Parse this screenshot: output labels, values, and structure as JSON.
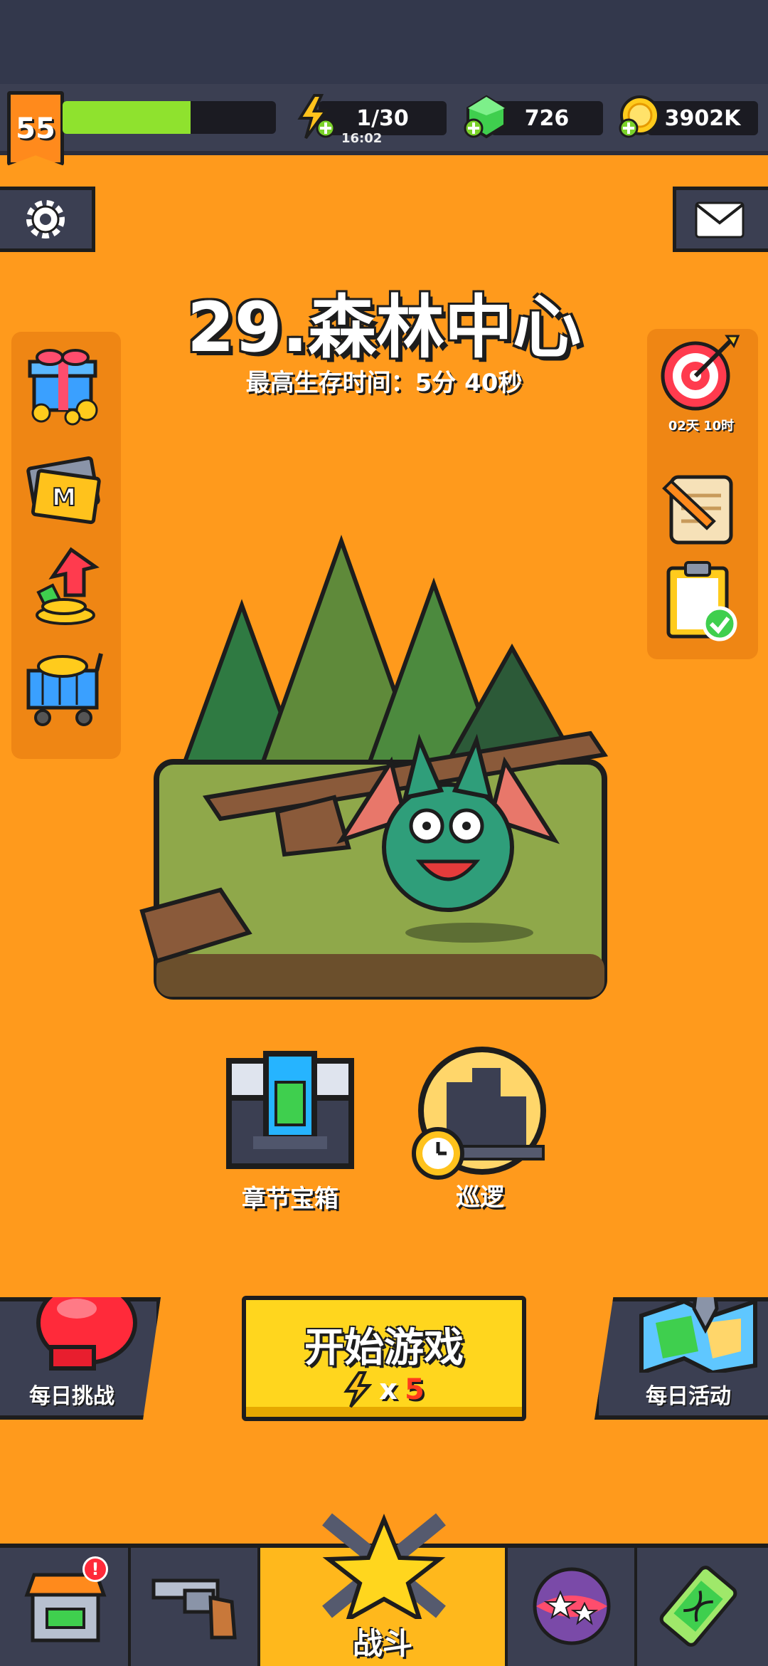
{
  "header": {
    "level": "55",
    "xp_progress": 0.6,
    "energy": "1/30",
    "energy_timer": "16:02",
    "gems": "726",
    "coins": "3902K"
  },
  "stage": {
    "title": "29.森林中心",
    "best_survival": "最高生存时间：5分 40秒"
  },
  "right_panel": {
    "target_timer": "02天 10时"
  },
  "middle_buttons": {
    "chapter_chest": "章节宝箱",
    "patrol": "巡逻"
  },
  "actions": {
    "daily_challenge": "每日挑战",
    "start_game": "开始游戏",
    "cost_prefix": "x",
    "cost_value": "5",
    "daily_event": "每日活动"
  },
  "nav": {
    "battle": "战斗",
    "shop_badge": "!"
  },
  "colors": {
    "background": "#ff9a1c",
    "bar_dark": "#3b3f52",
    "xp_fill": "#8fe22e",
    "start_button": "#ffd61e",
    "active_tab": "#ffb81c"
  }
}
